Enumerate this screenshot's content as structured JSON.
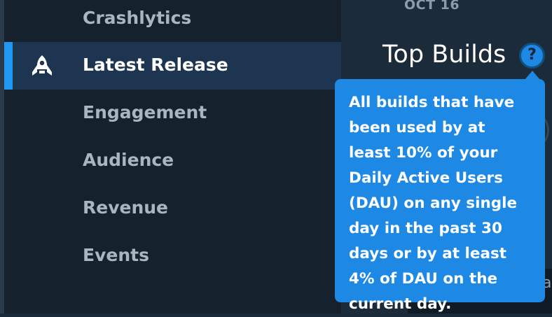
{
  "sidebar": {
    "items": [
      {
        "label": "Crashlytics",
        "active": false
      },
      {
        "label": "Latest Release",
        "active": true,
        "icon": "rocket-icon"
      },
      {
        "label": "Engagement",
        "active": false
      },
      {
        "label": "Audience",
        "active": false
      },
      {
        "label": "Revenue",
        "active": false
      },
      {
        "label": "Events",
        "active": false
      }
    ]
  },
  "main": {
    "date_label": "OCT 16",
    "section_title": "Top Builds",
    "help_icon": "question-circle-icon",
    "help_glyph": "?",
    "partial_text": "a"
  },
  "tooltip": {
    "text": "All builds that have been used by at least 10% of your Daily Active Users (DAU) on any single day in the past 30 days or by at least 4% of DAU on the current day."
  },
  "colors": {
    "sidebar_bg": "#15212d",
    "active_bg": "#1d3550",
    "accent": "#2196f3",
    "tooltip_bg": "#1e88e5",
    "main_bg": "#1c2b39",
    "inactive_text": "#a9b5c1"
  }
}
